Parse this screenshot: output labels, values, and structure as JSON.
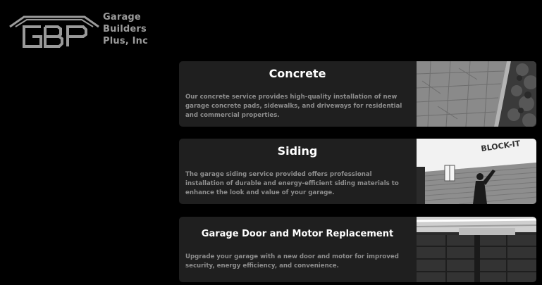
{
  "brand": {
    "logo_letters": "GBP",
    "name_lines": [
      "Garage",
      "Builders",
      "Plus, Inc"
    ]
  },
  "services": [
    {
      "title": "Concrete",
      "description": "Our concrete service provides high-quality installation of new garage concrete pads, sidewalks, and driveways for residential and commercial properties.",
      "image": "concrete-walkway-photo"
    },
    {
      "title": "Siding",
      "description": "The garage siding service provided offers professional installation of durable and energy-efficient siding materials to enhance the look and value of your garage.",
      "image": "siding-installer-photo"
    },
    {
      "title": "Garage Door and Motor Replacement",
      "description": "Upgrade your garage with a new door and motor for improved security, energy efficiency, and convenience.",
      "image": "garage-door-photo"
    }
  ],
  "photo_signage": {
    "siding_wrap": "BLOCK-IT"
  },
  "colors": {
    "background": "#000000",
    "card": "#1f1f1f",
    "title": "#ffffff",
    "body_text": "#8d8d8d",
    "logo": "#9a9a9a"
  }
}
